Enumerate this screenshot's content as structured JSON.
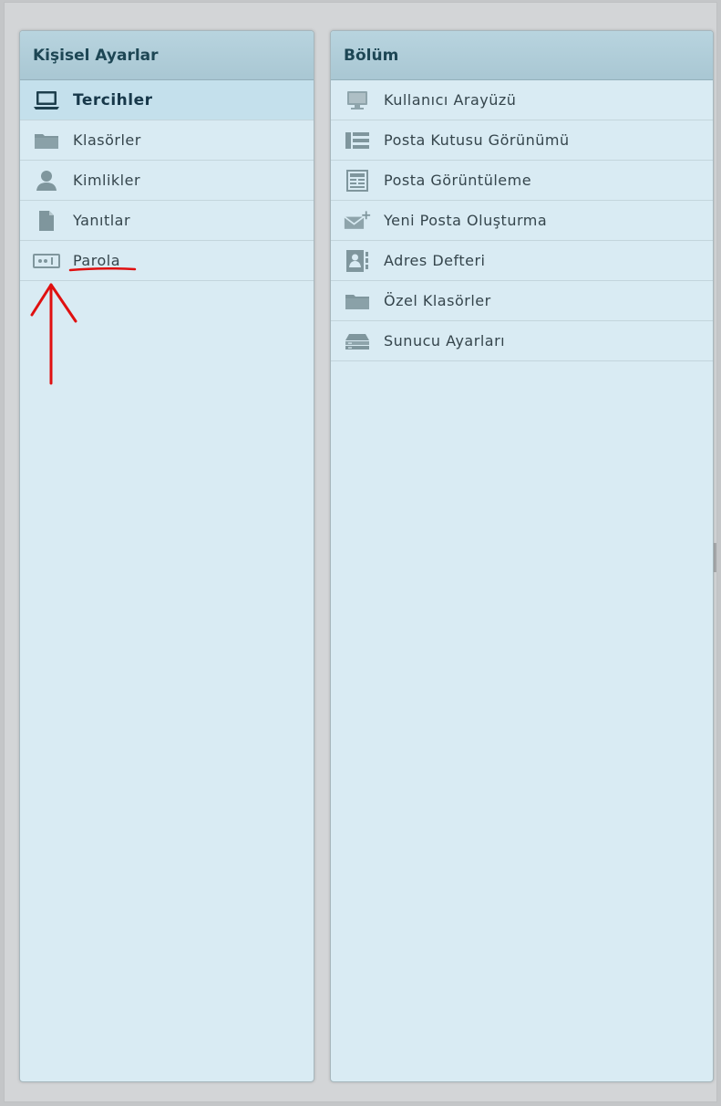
{
  "left_panel": {
    "title": "Kişisel Ayarlar",
    "items": [
      {
        "label": "Tercihler",
        "icon": "laptop-icon",
        "selected": true
      },
      {
        "label": "Klasörler",
        "icon": "folder-icon",
        "selected": false
      },
      {
        "label": "Kimlikler",
        "icon": "user-icon",
        "selected": false
      },
      {
        "label": "Yanıtlar",
        "icon": "document-icon",
        "selected": false
      },
      {
        "label": "Parola",
        "icon": "password-icon",
        "selected": false
      }
    ]
  },
  "right_panel": {
    "title": "Bölüm",
    "items": [
      {
        "label": "Kullanıcı Arayüzü",
        "icon": "monitor-icon"
      },
      {
        "label": "Posta Kutusu Görünümü",
        "icon": "list-view-icon"
      },
      {
        "label": "Posta Görüntüleme",
        "icon": "message-view-icon"
      },
      {
        "label": "Yeni Posta Oluşturma",
        "icon": "compose-mail-icon"
      },
      {
        "label": "Adres Defteri",
        "icon": "address-book-icon"
      },
      {
        "label": "Özel Klasörler",
        "icon": "folder-icon"
      },
      {
        "label": "Sunucu Ayarları",
        "icon": "server-icon"
      }
    ]
  },
  "colors": {
    "panel_bg": "#d9ebf3",
    "header_bg": "#a9c7d3",
    "selected_bg": "#c4e0ec",
    "annotation": "#e01010"
  },
  "annotations": {
    "arrow_target": "Parola",
    "underline_target": "Parola"
  }
}
